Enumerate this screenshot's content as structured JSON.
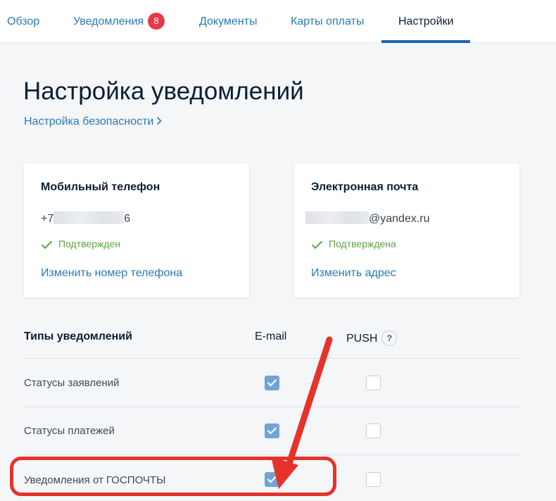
{
  "nav": {
    "tabs": [
      {
        "label": "Обзор"
      },
      {
        "label": "Уведомления",
        "badge": "8"
      },
      {
        "label": "Документы"
      },
      {
        "label": "Карты оплаты"
      },
      {
        "label": "Настройки"
      }
    ],
    "active_tab": "Настройки"
  },
  "page": {
    "title": "Настройка уведомлений",
    "security_link": "Настройка безопасности"
  },
  "cards": {
    "phone": {
      "title": "Мобильный телефон",
      "value_prefix": "+7",
      "value_suffix": "6",
      "status": "Подтвержден",
      "link": "Изменить номер телефона"
    },
    "email": {
      "title": "Электронная почта",
      "value_suffix": "@yandex.ru",
      "status": "Подтверждена",
      "link": "Изменить адрес"
    }
  },
  "table": {
    "header_types": "Типы уведомлений",
    "header_email": "E-mail",
    "header_push": "PUSH",
    "help_symbol": "?",
    "rows": [
      {
        "label": "Статусы заявлений",
        "email": true,
        "push": false
      },
      {
        "label": "Статусы платежей",
        "email": true,
        "push": false
      },
      {
        "label": "Уведомления от ГОСПОЧТЫ",
        "email": true,
        "push": false
      }
    ]
  },
  "colors": {
    "link": "#2b7ab5",
    "confirmed": "#5ea343",
    "badge": "#e63946",
    "checkbox_on": "#6fa4d8",
    "annotation": "#e5332a",
    "tab_underline": "#1a64b6"
  },
  "icons": {
    "chevron": "chevron-right-icon",
    "check": "checkmark-icon",
    "help": "question-icon",
    "annotation_arrow": "arrow-icon"
  }
}
